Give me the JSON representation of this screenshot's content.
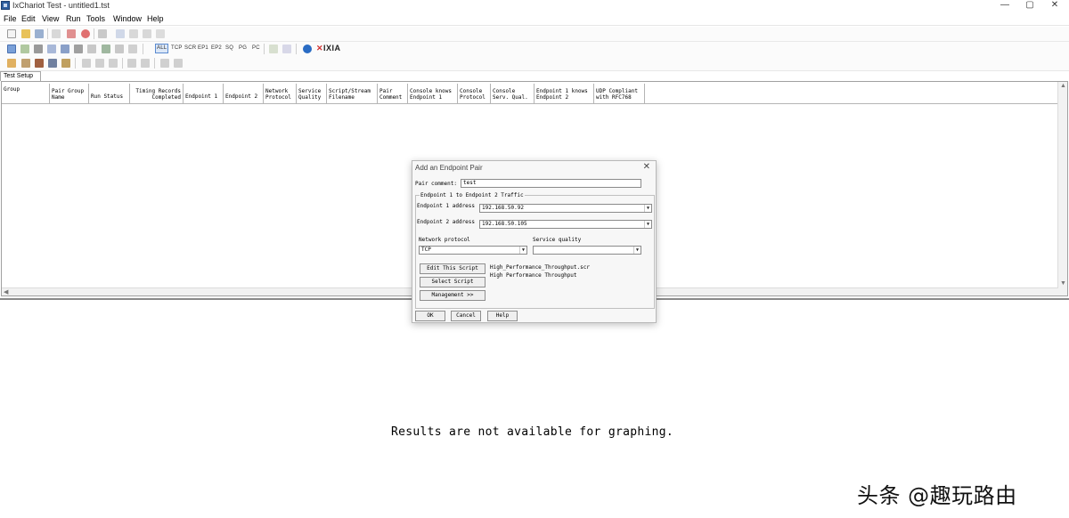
{
  "window": {
    "title": "IxChariot Test - untitled1.tst",
    "controls": {
      "minimize": "—",
      "maximize": "▢",
      "close": "✕"
    }
  },
  "menu": [
    "File",
    "Edit",
    "View",
    "Run",
    "Tools",
    "Window",
    "Help"
  ],
  "toolbar": {
    "filters": [
      "ALL",
      "TCP",
      "SCR",
      "EP1",
      "EP2",
      "SQ",
      "PG",
      "PC"
    ],
    "brand": "IXIA"
  },
  "tabs": [
    "Test Setup"
  ],
  "grid": {
    "columns": [
      {
        "top": "",
        "bottom": "Group"
      },
      {
        "top": "Pair Group",
        "bottom": "Name"
      },
      {
        "top": "",
        "bottom": "Run Status"
      },
      {
        "top": "Timing Records",
        "bottom": "Completed"
      },
      {
        "top": "",
        "bottom": "Endpoint 1"
      },
      {
        "top": "",
        "bottom": "Endpoint 2"
      },
      {
        "top": "Network",
        "bottom": "Protocol"
      },
      {
        "top": "Service",
        "bottom": "Quality"
      },
      {
        "top": "Script/Stream",
        "bottom": "Filename"
      },
      {
        "top": "Pair",
        "bottom": "Comment"
      },
      {
        "top": "Console knows",
        "bottom": "Endpoint 1"
      },
      {
        "top": "Console",
        "bottom": "Protocol"
      },
      {
        "top": "Console",
        "bottom": "Serv. Qual."
      },
      {
        "top": "Endpoint 1 knows",
        "bottom": "Endpoint 2"
      },
      {
        "top": "UDP Compliant",
        "bottom": "with RFC768"
      }
    ]
  },
  "results_message": "Results are not available for graphing.",
  "watermark": "头条 @趣玩路由",
  "dialog": {
    "title": "Add an Endpoint Pair",
    "pair_comment_label": "Pair comment:",
    "pair_comment_value": "test",
    "group_title": "Endpoint 1 to Endpoint 2 Traffic",
    "endpoint1_label": "Endpoint 1 address",
    "endpoint1_value": "192.168.50.92",
    "endpoint2_label": "Endpoint 2 address",
    "endpoint2_value": "192.168.50.105",
    "network_protocol_label": "Network protocol",
    "network_protocol_value": "TCP",
    "service_quality_label": "Service quality",
    "service_quality_value": "",
    "edit_script_button": "Edit This Script",
    "select_script_button": "Select Script",
    "management_button": "Management >>",
    "script_filename": "High_Performance_Throughput.scr",
    "script_description": "High Performance Throughput",
    "ok_button": "OK",
    "cancel_button": "Cancel",
    "help_button": "Help"
  }
}
